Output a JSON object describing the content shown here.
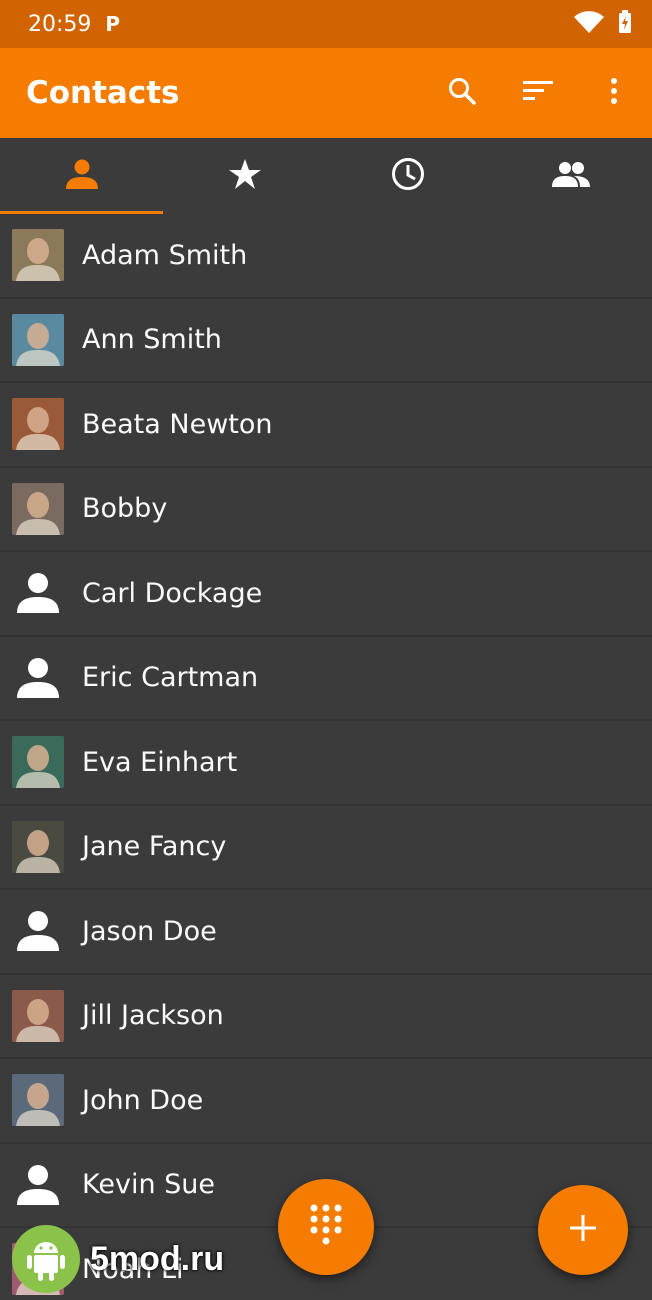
{
  "status_bar": {
    "time": "20:59",
    "notification_icon": "P",
    "icons": [
      "wifi-icon",
      "battery-charging-icon"
    ]
  },
  "app_bar": {
    "title": "Contacts",
    "actions": [
      "search-icon",
      "sort-icon",
      "more-vert-icon"
    ],
    "color": "#f57c00"
  },
  "tabs": [
    {
      "icon": "person-icon",
      "active": true
    },
    {
      "icon": "star-icon",
      "active": false
    },
    {
      "icon": "clock-icon",
      "active": false
    },
    {
      "icon": "group-icon",
      "active": false
    }
  ],
  "contacts": [
    {
      "name": "Adam Smith",
      "avatar": "photo",
      "color": "#8a7a5a"
    },
    {
      "name": "Ann Smith",
      "avatar": "photo",
      "color": "#5a8aa0"
    },
    {
      "name": "Beata Newton",
      "avatar": "photo",
      "color": "#9a5a3a"
    },
    {
      "name": "Bobby",
      "avatar": "photo",
      "color": "#7a6a60"
    },
    {
      "name": "Carl Dockage",
      "avatar": "placeholder"
    },
    {
      "name": "Eric Cartman",
      "avatar": "placeholder"
    },
    {
      "name": "Eva Einhart",
      "avatar": "photo",
      "color": "#3a6a5a"
    },
    {
      "name": "Jane Fancy",
      "avatar": "photo",
      "color": "#4a4a40"
    },
    {
      "name": "Jason Doe",
      "avatar": "placeholder"
    },
    {
      "name": "Jill Jackson",
      "avatar": "photo",
      "color": "#8a5a4a"
    },
    {
      "name": "John Doe",
      "avatar": "photo",
      "color": "#5a6a7a"
    },
    {
      "name": "Kevin Sue",
      "avatar": "placeholder"
    },
    {
      "name": "Noah Li",
      "avatar": "photo",
      "color": "#a05a70"
    }
  ],
  "fabs": {
    "dialpad": "dialpad-icon",
    "add": "add-icon"
  },
  "watermark": {
    "text": "5mod.ru",
    "icon": "android-icon"
  }
}
